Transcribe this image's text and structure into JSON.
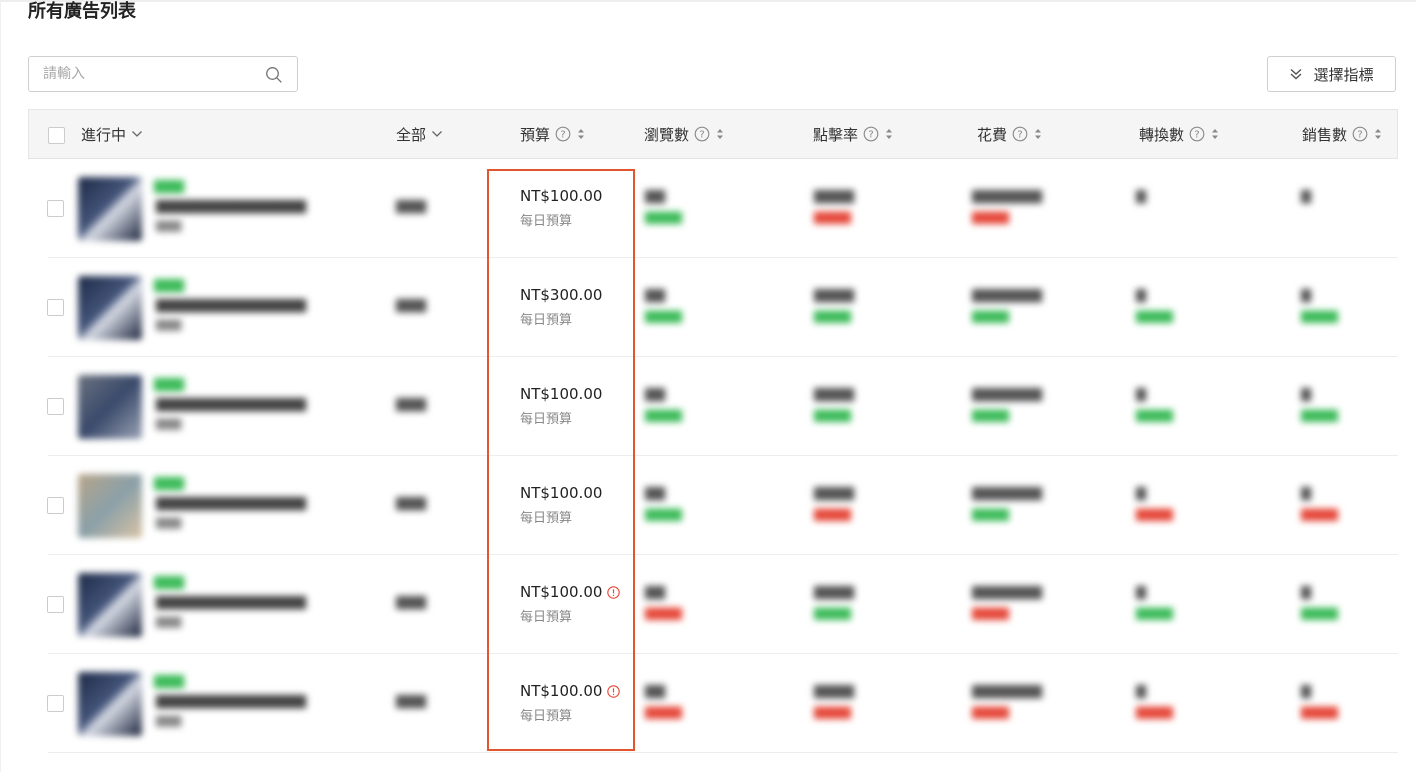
{
  "page": {
    "title": "所有廣告列表"
  },
  "search": {
    "placeholder": "請輸入"
  },
  "toolbar": {
    "metric_button_label": "選擇指標"
  },
  "table": {
    "headers": {
      "status": "進行中",
      "scope": "全部",
      "budget": "預算",
      "views": "瀏覽數",
      "ctr": "點擊率",
      "spend": "花費",
      "conversions": "轉換數",
      "sales": "銷售數"
    },
    "rows": [
      {
        "budget": "NT$100.00",
        "budget_type": "每日預算",
        "warning": false,
        "thumb": "t1"
      },
      {
        "budget": "NT$300.00",
        "budget_type": "每日預算",
        "warning": false,
        "thumb": "t1"
      },
      {
        "budget": "NT$100.00",
        "budget_type": "每日預算",
        "warning": false,
        "thumb": "t3"
      },
      {
        "budget": "NT$100.00",
        "budget_type": "每日預算",
        "warning": false,
        "thumb": "t4"
      },
      {
        "budget": "NT$100.00",
        "budget_type": "每日預算",
        "warning": true,
        "thumb": "t1"
      },
      {
        "budget": "NT$100.00",
        "budget_type": "每日預算",
        "warning": true,
        "thumb": "t1"
      }
    ]
  },
  "colors": {
    "highlight": "#e2562f",
    "positive": "#3dbb5a",
    "negative": "#e5483a",
    "warning": "#e5483a"
  },
  "icons": {
    "search": "search-icon",
    "help": "help-circle-icon",
    "sort": "sort-icon",
    "warning": "warning-icon",
    "dropdown": "chevron-down-icon",
    "metrics": "double-chevron-down-icon"
  }
}
